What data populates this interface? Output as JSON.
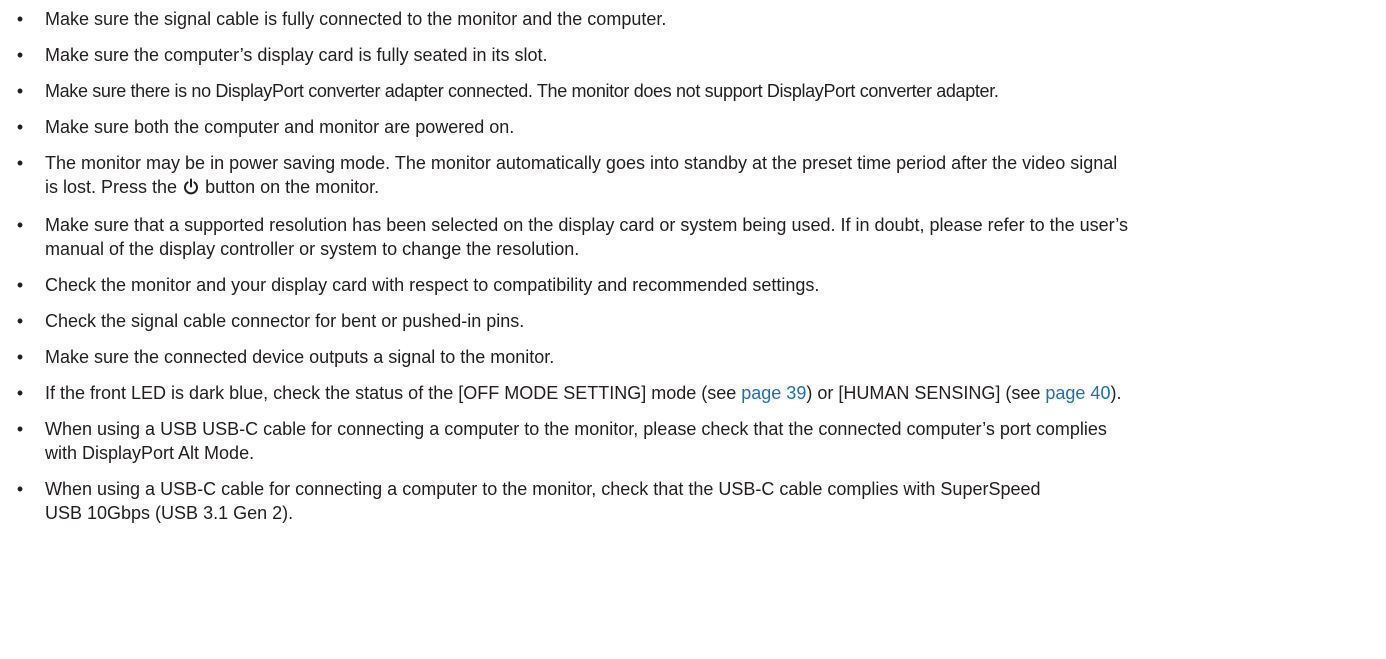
{
  "bullet_glyph": "•",
  "icons": {
    "power": "power-icon"
  },
  "colors": {
    "text": "#231f20",
    "link": "#1f6fb5"
  },
  "items": [
    {
      "text": "Make sure the signal cable is fully connected to the monitor and the computer."
    },
    {
      "text": "Make sure the computer’s display card is fully seated in its slot."
    },
    {
      "text": "Make sure there is no DisplayPort converter adapter connected. The monitor does not support DisplayPort converter adapter."
    },
    {
      "text": "Make sure both the computer and monitor are powered on."
    },
    {
      "before_icon": "The monitor may be in power saving mode. The monitor automatically goes into standby at the preset time period after the video signal is lost. Press the ",
      "after_icon": " button on the monitor."
    },
    {
      "text": "Make sure that a supported resolution has been selected on the display card or system being used. If in doubt, please refer to the user’s manual of the display controller or system to change the resolution."
    },
    {
      "text": "Check the monitor and your display card with respect to compatibility and recommended settings."
    },
    {
      "text": "Check the signal cable connector for bent or pushed-in pins."
    },
    {
      "text": "Make sure the connected device outputs a signal to the monitor."
    },
    {
      "part1": "If the front LED is dark blue, check the status of the [OFF MODE SETTING] mode (see ",
      "link1": "page 39",
      "part2": ") or [HUMAN SENSING] (see ",
      "link2": "page 40",
      "part3": ")."
    },
    {
      "text": "When using a USB USB-C cable for connecting a computer to the monitor, please check that the connected computer’s port complies with DisplayPort Alt Mode."
    },
    {
      "text": "When using a USB-C cable for connecting a computer to the monitor, check that the USB-C cable complies with SuperSpeed USB 10Gbps (USB 3.1 Gen 2)."
    }
  ]
}
